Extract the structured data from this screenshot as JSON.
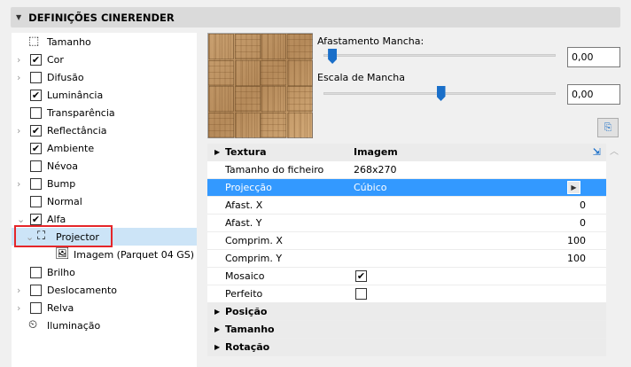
{
  "header": {
    "title": "DEFINIÇÕES CINERENDER"
  },
  "tree": [
    {
      "label": "Tamanho",
      "type": "icon",
      "icon": "size-icon"
    },
    {
      "label": "Cor",
      "checked": true,
      "chevron": "right"
    },
    {
      "label": "Difusão",
      "checked": false,
      "chevron": "right"
    },
    {
      "label": "Luminância",
      "checked": true
    },
    {
      "label": "Transparência",
      "checked": false
    },
    {
      "label": "Reflectância",
      "checked": true,
      "chevron": "right"
    },
    {
      "label": "Ambiente",
      "checked": true
    },
    {
      "label": "Névoa",
      "checked": false
    },
    {
      "label": "Bump",
      "checked": false,
      "chevron": "right"
    },
    {
      "label": "Normal",
      "checked": false
    },
    {
      "label": "Alfa",
      "checked": true,
      "chevron": "down"
    },
    {
      "label": "Projector",
      "type": "projector",
      "chevron": "down",
      "selected": true
    },
    {
      "label": "Imagem (Parquet 04 GS)",
      "type": "image"
    },
    {
      "label": "Brilho",
      "checked": false
    },
    {
      "label": "Deslocamento",
      "checked": false,
      "chevron": "right"
    },
    {
      "label": "Relva",
      "checked": false,
      "chevron": "right"
    },
    {
      "label": "Iluminação",
      "type": "icon",
      "icon": "illumination-icon"
    }
  ],
  "sliders": [
    {
      "label": "Afastamento Mancha:",
      "value": "0,00",
      "position": 0.02
    },
    {
      "label": "Escala de Mancha",
      "value": "0,00",
      "position": 0.5
    }
  ],
  "table": {
    "header": {
      "c1": "Textura",
      "c2": "Imagem"
    },
    "rows": [
      {
        "c1": "Tamanho do ficheiro",
        "c2": "268x270"
      },
      {
        "c1": "Projecção",
        "c2": "Cúbico"
      },
      {
        "c1": "Afast. X",
        "c3": "0"
      },
      {
        "c1": "Afast. Y",
        "c3": "0"
      },
      {
        "c1": "Comprim. X",
        "c3": "100"
      },
      {
        "c1": "Comprim. Y",
        "c3": "100"
      },
      {
        "c1": "Mosaico",
        "check": true
      },
      {
        "c1": "Perfeito",
        "check": false
      }
    ],
    "groups": [
      "Posição",
      "Tamanho",
      "Rotação"
    ]
  }
}
